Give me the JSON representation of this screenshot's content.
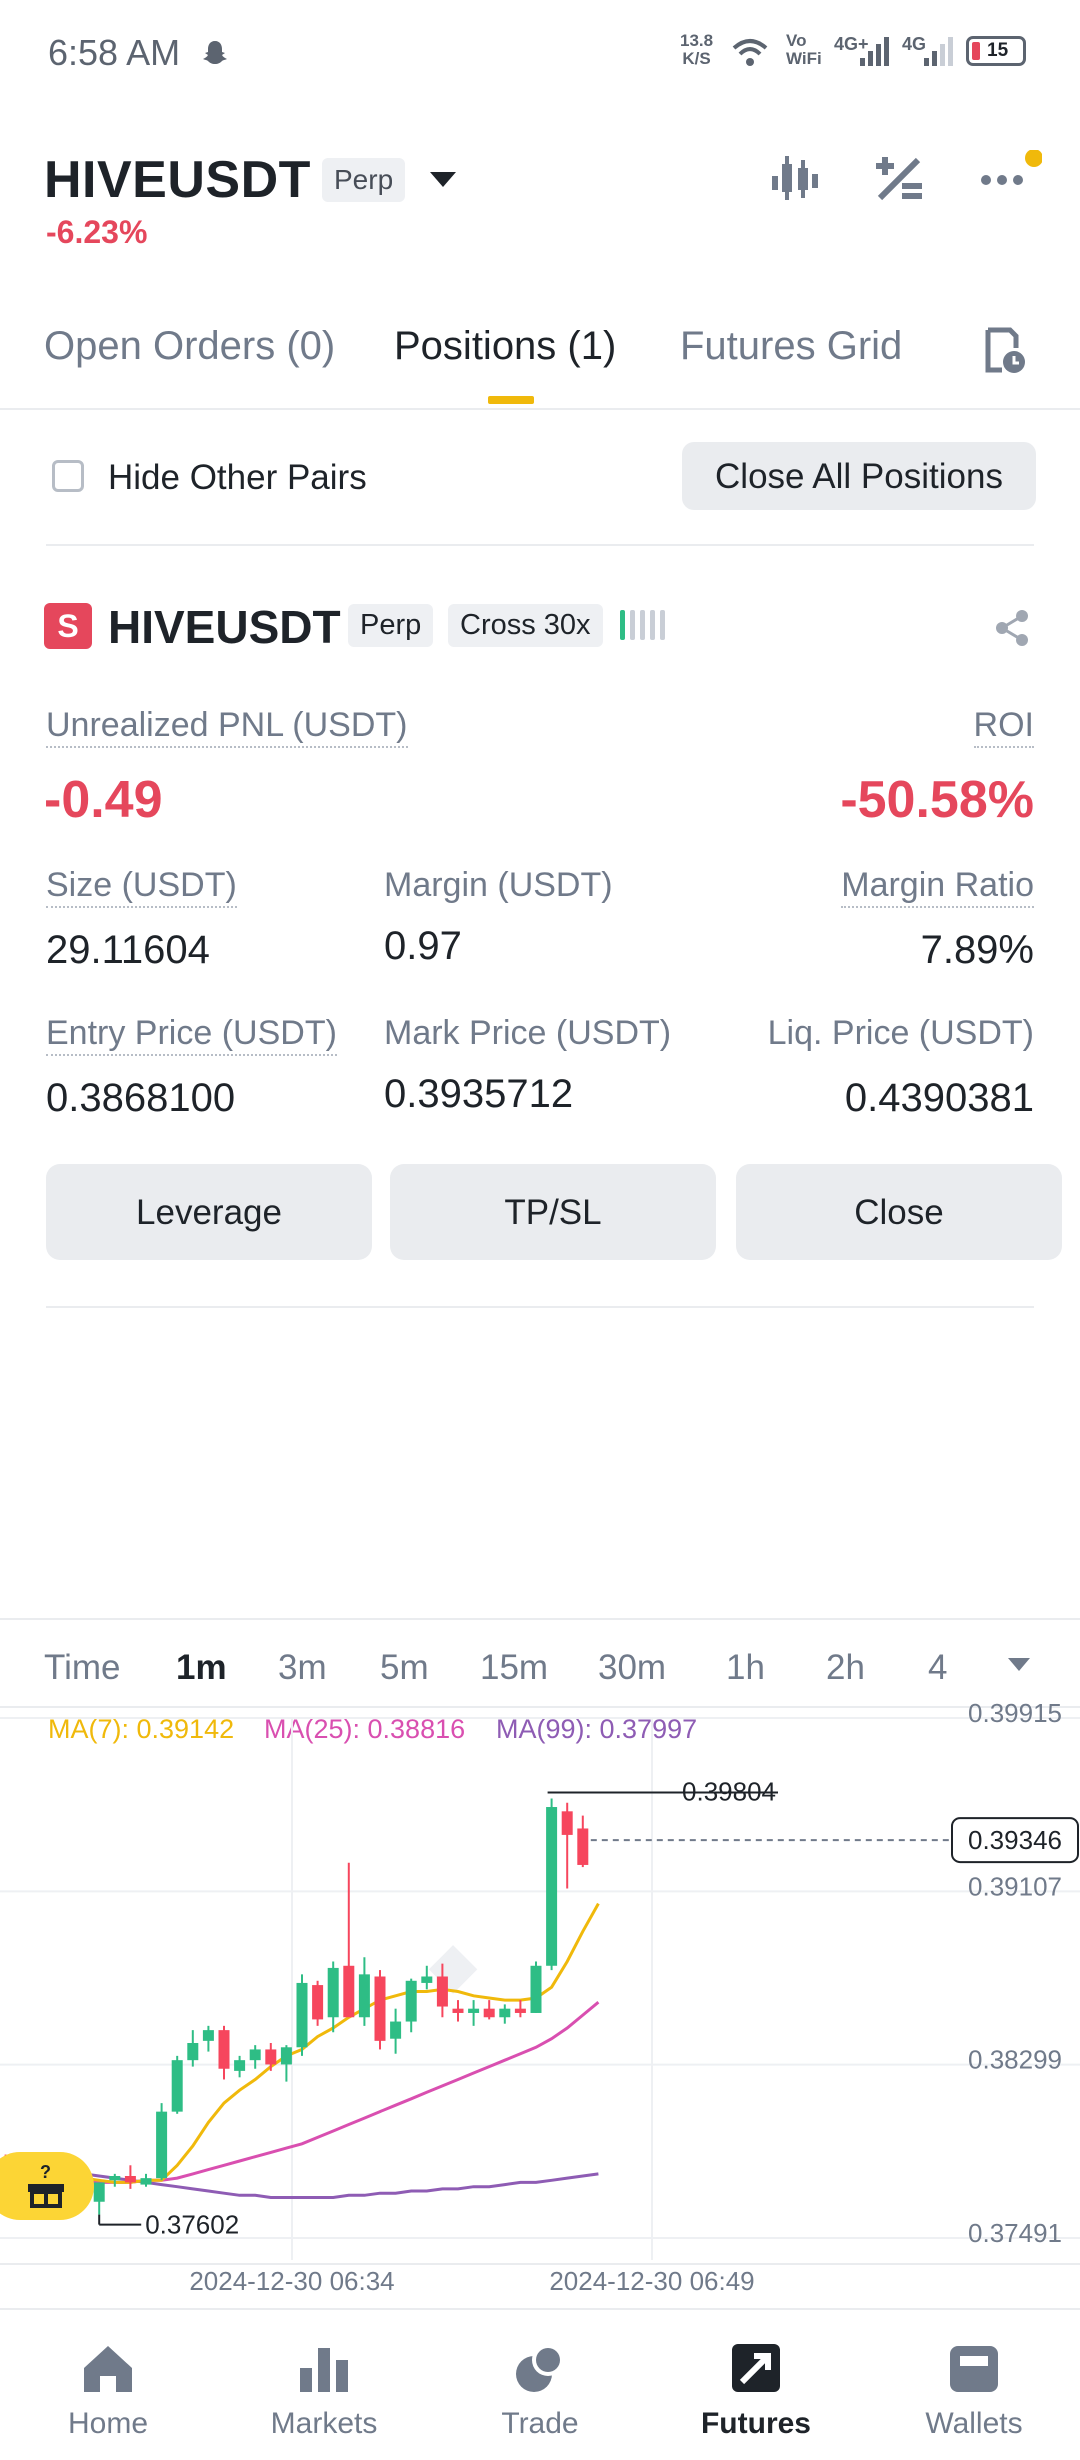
{
  "status_bar": {
    "time": "6:58 AM",
    "speed_value": "13.8",
    "speed_unit": "K/S",
    "vowifi_top": "Vo",
    "vowifi_bottom": "WiFi",
    "net1": "4G+",
    "net2": "4G",
    "battery": "15"
  },
  "header": {
    "symbol": "HIVEUSDT",
    "badge": "Perp",
    "change": "-6.23%"
  },
  "tabs": [
    {
      "label": "Open Orders (0)",
      "active": false
    },
    {
      "label": "Positions (1)",
      "active": true
    },
    {
      "label": "Futures Grid",
      "active": false
    }
  ],
  "filters": {
    "hide_label": "Hide Other Pairs",
    "hide_checked": false,
    "close_all_label": "Close All Positions"
  },
  "position": {
    "side_badge": "S",
    "symbol": "HIVEUSDT",
    "type": "Perp",
    "margin_mode": "Cross 30x",
    "unrealized_pnl_label": "Unrealized PNL (USDT)",
    "unrealized_pnl": "-0.49",
    "roi_label": "ROI",
    "roi": "-50.58%",
    "size_label": "Size (USDT)",
    "size": "29.11604",
    "margin_label": "Margin (USDT)",
    "margin": "0.97",
    "margin_ratio_label": "Margin Ratio",
    "margin_ratio": "7.89%",
    "entry_price_label": "Entry Price (USDT)",
    "entry_price": "0.3868100",
    "mark_price_label": "Mark Price (USDT)",
    "mark_price": "0.3935712",
    "liq_price_label": "Liq. Price (USDT)",
    "liq_price": "0.4390381",
    "buttons": {
      "leverage": "Leverage",
      "tpsl": "TP/SL",
      "close": "Close"
    }
  },
  "chart": {
    "timeframes": [
      "Time",
      "1m",
      "3m",
      "5m",
      "15m",
      "30m",
      "1h",
      "2h",
      "4"
    ],
    "active_timeframe": "1m",
    "ma7": "MA(7): 0.39142",
    "ma25": "MA(25): 0.38816",
    "ma99": "MA(99): 0.37997",
    "colors": {
      "up": "#2ebd85",
      "down": "#f6465d",
      "ma7": "#f0b90b",
      "ma25": "#d94fb0",
      "ma99": "#8e5cb4"
    }
  },
  "chart_data": {
    "type": "candlestick",
    "title": "",
    "x_labels": [
      "2024-12-30 06:34",
      "2024-12-30 06:49"
    ],
    "y_ticks": [
      "0.39915",
      "0.39107",
      "0.38299",
      "0.37491"
    ],
    "ylim": [
      0.37491,
      0.39915
    ],
    "high_label": "0.39804",
    "low_label": "0.37602",
    "last_price_label": "0.39346",
    "candles": [
      {
        "o": 0.3787,
        "h": 0.379,
        "l": 0.3778,
        "c": 0.3783
      },
      {
        "o": 0.3784,
        "h": 0.3788,
        "l": 0.3777,
        "c": 0.3782
      },
      {
        "o": 0.3782,
        "h": 0.3789,
        "l": 0.3776,
        "c": 0.3786
      },
      {
        "o": 0.3786,
        "h": 0.3789,
        "l": 0.377,
        "c": 0.3773
      },
      {
        "o": 0.3773,
        "h": 0.3778,
        "l": 0.3767,
        "c": 0.3774
      },
      {
        "o": 0.3774,
        "h": 0.378,
        "l": 0.3766,
        "c": 0.3776
      },
      {
        "o": 0.3778,
        "h": 0.3779,
        "l": 0.3764,
        "c": 0.3766
      },
      {
        "o": 0.3766,
        "h": 0.3775,
        "l": 0.376,
        "c": 0.3775
      },
      {
        "o": 0.3776,
        "h": 0.3779,
        "l": 0.3773,
        "c": 0.3778
      },
      {
        "o": 0.3778,
        "h": 0.3783,
        "l": 0.3772,
        "c": 0.3775
      },
      {
        "o": 0.3774,
        "h": 0.3779,
        "l": 0.3773,
        "c": 0.3777
      },
      {
        "o": 0.3777,
        "h": 0.3812,
        "l": 0.3776,
        "c": 0.3808
      },
      {
        "o": 0.3808,
        "h": 0.3834,
        "l": 0.3807,
        "c": 0.3832
      },
      {
        "o": 0.3832,
        "h": 0.3846,
        "l": 0.3829,
        "c": 0.384
      },
      {
        "o": 0.3841,
        "h": 0.3848,
        "l": 0.3836,
        "c": 0.3846
      },
      {
        "o": 0.3846,
        "h": 0.3848,
        "l": 0.3823,
        "c": 0.3828
      },
      {
        "o": 0.3827,
        "h": 0.3834,
        "l": 0.3824,
        "c": 0.3832
      },
      {
        "o": 0.3832,
        "h": 0.3839,
        "l": 0.3828,
        "c": 0.3837
      },
      {
        "o": 0.3837,
        "h": 0.384,
        "l": 0.3827,
        "c": 0.383
      },
      {
        "o": 0.383,
        "h": 0.3839,
        "l": 0.3822,
        "c": 0.3838
      },
      {
        "o": 0.3838,
        "h": 0.3872,
        "l": 0.3834,
        "c": 0.3868
      },
      {
        "o": 0.3867,
        "h": 0.3869,
        "l": 0.3848,
        "c": 0.3851
      },
      {
        "o": 0.3852,
        "h": 0.3878,
        "l": 0.3845,
        "c": 0.3875
      },
      {
        "o": 0.3876,
        "h": 0.3924,
        "l": 0.3858,
        "c": 0.3852
      },
      {
        "o": 0.3852,
        "h": 0.388,
        "l": 0.3848,
        "c": 0.3872
      },
      {
        "o": 0.3871,
        "h": 0.3874,
        "l": 0.3837,
        "c": 0.3841
      },
      {
        "o": 0.3842,
        "h": 0.3856,
        "l": 0.3835,
        "c": 0.385
      },
      {
        "o": 0.385,
        "h": 0.387,
        "l": 0.3845,
        "c": 0.3869
      },
      {
        "o": 0.3868,
        "h": 0.3876,
        "l": 0.3865,
        "c": 0.3871
      },
      {
        "o": 0.3871,
        "h": 0.3877,
        "l": 0.3852,
        "c": 0.3857
      },
      {
        "o": 0.3856,
        "h": 0.386,
        "l": 0.385,
        "c": 0.3854
      },
      {
        "o": 0.3854,
        "h": 0.386,
        "l": 0.3848,
        "c": 0.3856
      },
      {
        "o": 0.3856,
        "h": 0.386,
        "l": 0.3851,
        "c": 0.3852
      },
      {
        "o": 0.3852,
        "h": 0.3858,
        "l": 0.3849,
        "c": 0.3856
      },
      {
        "o": 0.3856,
        "h": 0.386,
        "l": 0.3852,
        "c": 0.3854
      },
      {
        "o": 0.3854,
        "h": 0.3878,
        "l": 0.3854,
        "c": 0.3876
      },
      {
        "o": 0.3876,
        "h": 0.3954,
        "l": 0.3874,
        "c": 0.395
      },
      {
        "o": 0.3948,
        "h": 0.3952,
        "l": 0.3912,
        "c": 0.3937
      },
      {
        "o": 0.394,
        "h": 0.3946,
        "l": 0.3922,
        "c": 0.3923
      }
    ],
    "ma7_values": [
      0.3787,
      0.3785,
      0.3783,
      0.3781,
      0.3779,
      0.3777,
      0.3776,
      0.3775,
      0.3775,
      0.3776,
      0.3776,
      0.3783,
      0.3792,
      0.3803,
      0.3812,
      0.3818,
      0.3823,
      0.3829,
      0.3834,
      0.3837,
      0.3843,
      0.3847,
      0.3852,
      0.3856,
      0.386,
      0.3862,
      0.3864,
      0.3864,
      0.3865,
      0.3864,
      0.3862,
      0.3861,
      0.386,
      0.386,
      0.3861,
      0.3866,
      0.3878,
      0.3892,
      0.3905
    ],
    "ma25_values": [
      0.3778,
      0.3777,
      0.3776,
      0.3776,
      0.3775,
      0.3775,
      0.3775,
      0.3775,
      0.3775,
      0.3776,
      0.3776,
      0.3777,
      0.3779,
      0.3781,
      0.3783,
      0.3785,
      0.3787,
      0.3789,
      0.3791,
      0.3793,
      0.3796,
      0.3799,
      0.3802,
      0.3805,
      0.3808,
      0.3811,
      0.3814,
      0.3817,
      0.382,
      0.3823,
      0.3826,
      0.3829,
      0.3832,
      0.3835,
      0.3838,
      0.3842,
      0.3847,
      0.3853,
      0.3859
    ],
    "ma99_values": [
      0.3784,
      0.3783,
      0.3782,
      0.3781,
      0.378,
      0.3779,
      0.3778,
      0.3777,
      0.3776,
      0.3775,
      0.3774,
      0.3773,
      0.3772,
      0.3771,
      0.377,
      0.3769,
      0.3769,
      0.3768,
      0.3768,
      0.3768,
      0.3768,
      0.3768,
      0.3769,
      0.3769,
      0.377,
      0.377,
      0.3771,
      0.3771,
      0.3772,
      0.3772,
      0.3773,
      0.3773,
      0.3774,
      0.3775,
      0.3775,
      0.3776,
      0.3777,
      0.3778,
      0.3779
    ]
  },
  "bottom_nav": [
    {
      "label": "Home",
      "icon": "home-icon",
      "active": false
    },
    {
      "label": "Markets",
      "icon": "markets-icon",
      "active": false
    },
    {
      "label": "Trade",
      "icon": "trade-icon",
      "active": false
    },
    {
      "label": "Futures",
      "icon": "futures-icon",
      "active": true
    },
    {
      "label": "Wallets",
      "icon": "wallet-icon",
      "active": false
    }
  ]
}
